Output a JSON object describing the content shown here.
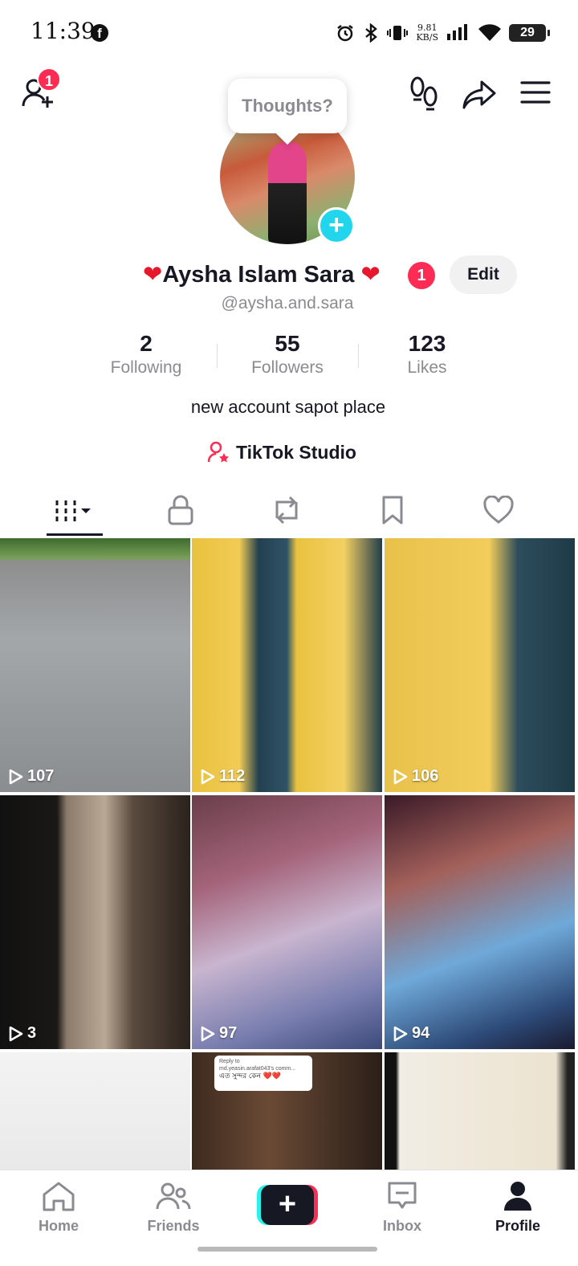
{
  "status_bar": {
    "time": "11:39",
    "fb_icon": "f",
    "net_speed_top": "9.81",
    "net_speed_unit": "KB/S",
    "battery": "29"
  },
  "header": {
    "friend_badge": "1",
    "tooltip": "Thoughts?"
  },
  "profile": {
    "name": "Aysha Islam Sara",
    "name_badge": "1",
    "edit_label": "Edit",
    "handle": "@aysha.and.sara",
    "bio": "new account sapot place",
    "studio_label": "TikTok Studio"
  },
  "stats": [
    {
      "value": "2",
      "label": "Following"
    },
    {
      "value": "55",
      "label": "Followers"
    },
    {
      "value": "123",
      "label": "Likes"
    }
  ],
  "videos": [
    {
      "views": "107"
    },
    {
      "views": "112"
    },
    {
      "views": "106"
    },
    {
      "views": "3"
    },
    {
      "views": "97"
    },
    {
      "views": "94"
    },
    {
      "views": ""
    },
    {
      "views": ""
    },
    {
      "views": ""
    }
  ],
  "video_overlay": {
    "reply_title": "Reply to",
    "reply_user": "md.yeasin.arafat043's comm...",
    "reply_text": "এত সুন্দর কেন ❤️❤️"
  },
  "nav": {
    "home": "Home",
    "friends": "Friends",
    "inbox": "Inbox",
    "profile": "Profile"
  },
  "colors": {
    "accent_red": "#fe2c55",
    "accent_cyan": "#25f4ee",
    "text_primary": "#161823",
    "text_secondary": "#8a8b91"
  }
}
